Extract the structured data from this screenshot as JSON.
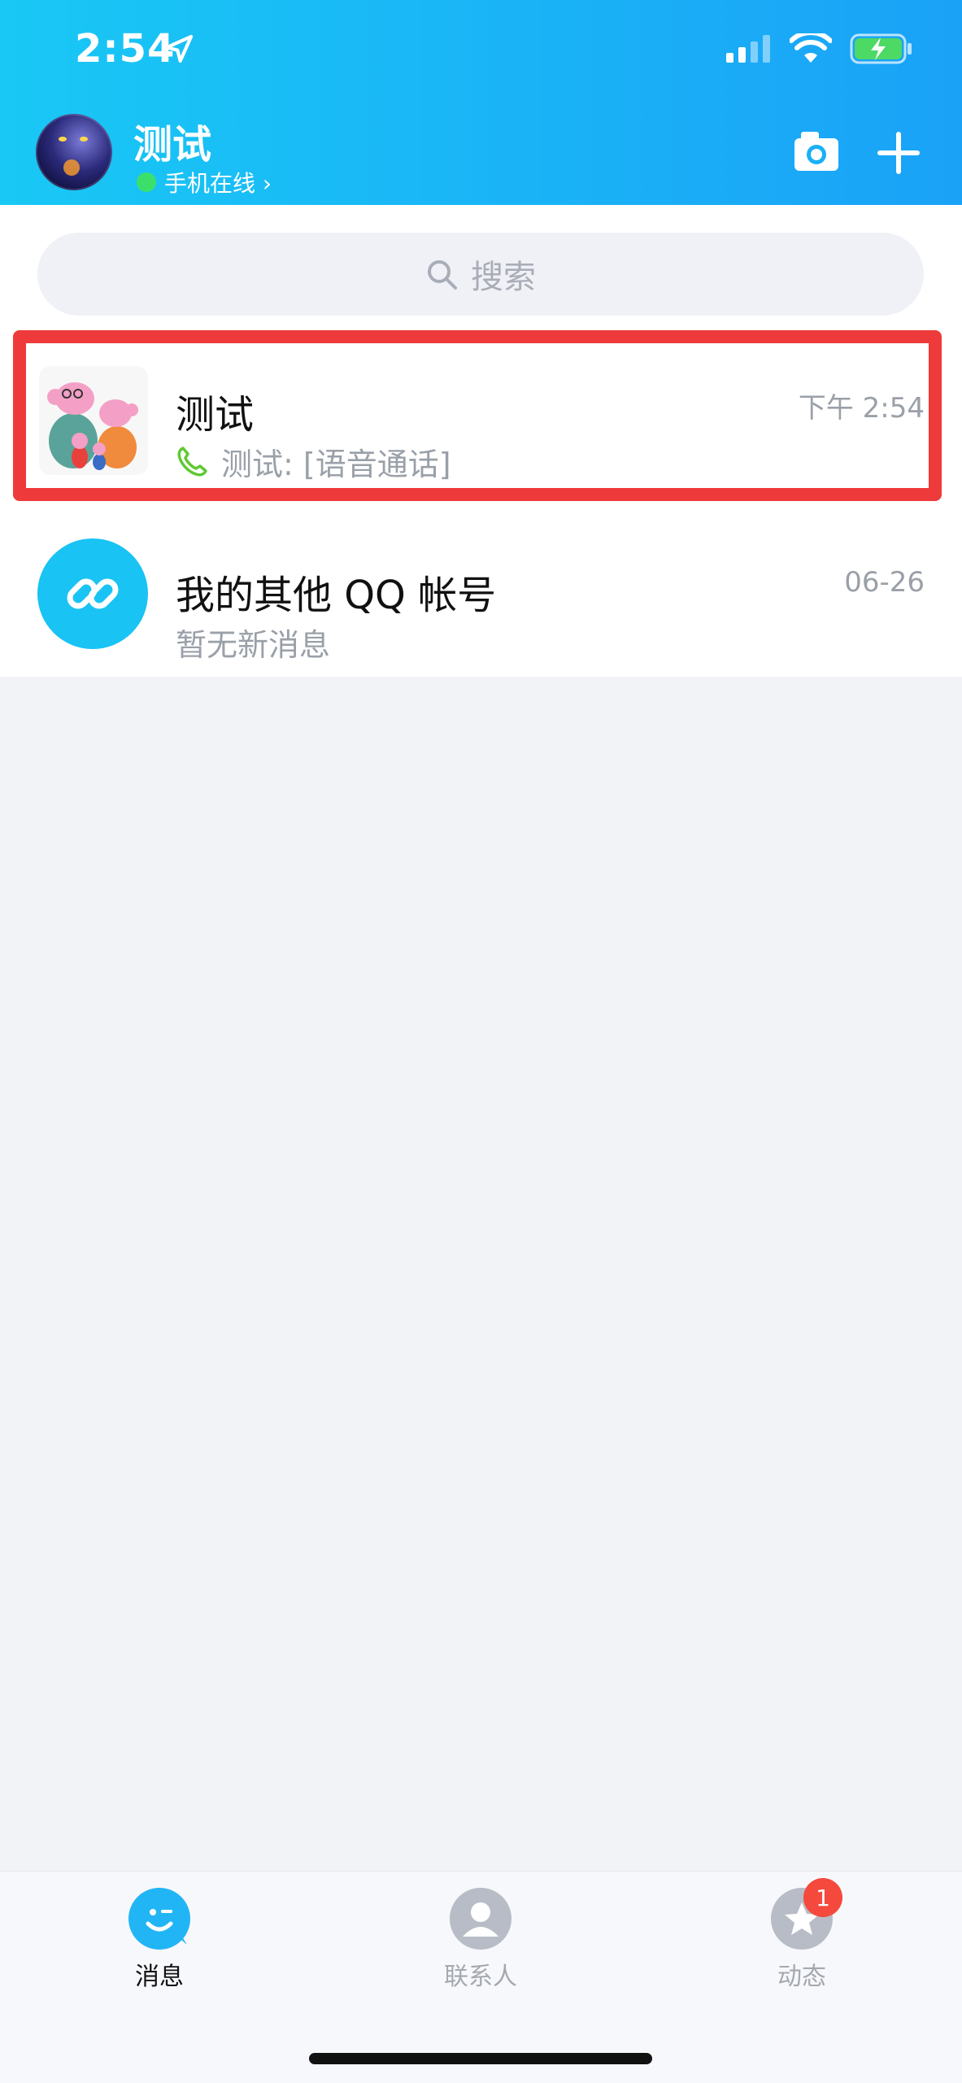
{
  "status_bar": {
    "time": "2:54"
  },
  "header": {
    "profile_name": "测试",
    "online_status": "手机在线 ›"
  },
  "search": {
    "placeholder": "搜索"
  },
  "conversations": [
    {
      "title": "测试",
      "time": "下午 2:54",
      "preview": "测试: [语音通话]",
      "highlighted": true
    },
    {
      "title": "我的其他 QQ 帐号",
      "time": "06-26",
      "preview": "暂无新消息"
    }
  ],
  "tabs": [
    {
      "label": "消息",
      "active": true
    },
    {
      "label": "联系人"
    },
    {
      "label": "动态",
      "badge": "1"
    }
  ],
  "colors": {
    "header_start": "#19c8f5",
    "header_end": "#1aa2f7",
    "highlight": "#ee3a3a",
    "link_avatar": "#19c3f3",
    "badge": "#f4493c"
  }
}
